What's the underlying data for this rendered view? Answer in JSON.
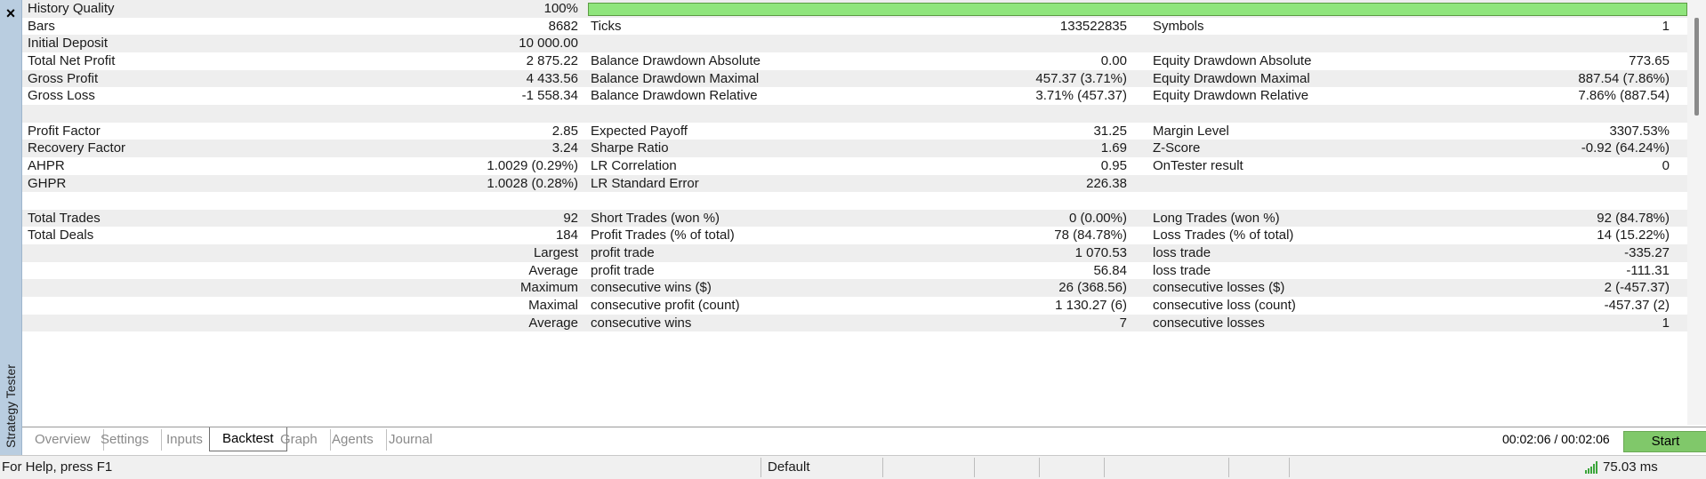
{
  "panel": {
    "title": "Strategy Tester",
    "close_glyph": "×"
  },
  "rows": [
    {
      "shade": true,
      "l1": "History Quality",
      "v1": "100%",
      "bar_fill": 1.0
    },
    {
      "shade": false,
      "l1": "Bars",
      "v1": "8682",
      "l2": "Ticks",
      "v2": "133522835",
      "l3": "Symbols",
      "v3": "1"
    },
    {
      "shade": true,
      "l1": "Initial Deposit",
      "v1": "10 000.00"
    },
    {
      "shade": false,
      "l1": "Total Net Profit",
      "v1": "2 875.22",
      "l2": "Balance Drawdown Absolute",
      "v2": "0.00",
      "l3": "Equity Drawdown Absolute",
      "v3": "773.65"
    },
    {
      "shade": true,
      "l1": "Gross Profit",
      "v1": "4 433.56",
      "l2": "Balance Drawdown Maximal",
      "v2": "457.37 (3.71%)",
      "l3": "Equity Drawdown Maximal",
      "v3": "887.54 (7.86%)"
    },
    {
      "shade": false,
      "l1": "Gross Loss",
      "v1": "-1 558.34",
      "l2": "Balance Drawdown Relative",
      "v2": "3.71% (457.37)",
      "l3": "Equity Drawdown Relative",
      "v3": "7.86% (887.54)"
    },
    {
      "shade": true
    },
    {
      "shade": false,
      "l1": "Profit Factor",
      "v1": "2.85",
      "l2": "Expected Payoff",
      "v2": "31.25",
      "l3": "Margin Level",
      "v3": "3307.53%"
    },
    {
      "shade": true,
      "l1": "Recovery Factor",
      "v1": "3.24",
      "l2": "Sharpe Ratio",
      "v2": "1.69",
      "l3": "Z-Score",
      "v3": "-0.92 (64.24%)"
    },
    {
      "shade": false,
      "l1": "AHPR",
      "v1": "1.0029 (0.29%)",
      "l2": "LR Correlation",
      "v2": "0.95",
      "l3": "OnTester result",
      "v3": "0"
    },
    {
      "shade": true,
      "l1": "GHPR",
      "v1": "1.0028 (0.28%)",
      "l2": "LR Standard Error",
      "v2": "226.38"
    },
    {
      "shade": false
    },
    {
      "shade": true,
      "l1": "Total Trades",
      "v1": "92",
      "l2": "Short Trades (won %)",
      "v2": "0 (0.00%)",
      "l3": "Long Trades (won %)",
      "v3": "92 (84.78%)"
    },
    {
      "shade": false,
      "l1": "Total Deals",
      "v1": "184",
      "l2": "Profit Trades (% of total)",
      "v2": "78 (84.78%)",
      "l3": "Loss Trades (% of total)",
      "v3": "14 (15.22%)"
    },
    {
      "shade": true,
      "r1": "Largest",
      "l2": "profit trade",
      "v2": "1 070.53",
      "l3": "loss trade",
      "v3": "-335.27"
    },
    {
      "shade": false,
      "r1": "Average",
      "l2": "profit trade",
      "v2": "56.84",
      "l3": "loss trade",
      "v3": "-111.31"
    },
    {
      "shade": true,
      "r1": "Maximum",
      "l2": "consecutive wins ($)",
      "v2": "26 (368.56)",
      "l3": "consecutive losses ($)",
      "v3": "2 (-457.37)"
    },
    {
      "shade": false,
      "r1": "Maximal",
      "l2": "consecutive profit (count)",
      "v2": "1 130.27 (6)",
      "l3": "consecutive loss (count)",
      "v3": "-457.37 (2)"
    },
    {
      "shade": true,
      "r1": "Average",
      "l2": "consecutive wins",
      "v2": "7",
      "l3": "consecutive losses",
      "v3": "1"
    }
  ],
  "tabs": [
    {
      "label": "Overview",
      "active": false
    },
    {
      "label": "Settings",
      "active": false
    },
    {
      "label": "Inputs",
      "active": false
    },
    {
      "label": "Backtest",
      "active": true
    },
    {
      "label": "Graph",
      "active": false
    },
    {
      "label": "Agents",
      "active": false
    },
    {
      "label": "Journal",
      "active": false
    }
  ],
  "timer": "00:02:06 / 00:02:06",
  "start_label": "Start",
  "status": {
    "help": "For Help, press F1",
    "profile": "Default",
    "ping": "75.03 ms"
  },
  "colors": {
    "quality_bar": "#8fe57c",
    "start_button": "#80c86a",
    "side_strip": "#b9cde0",
    "row_shade": "#eeeeee"
  },
  "icons": {
    "close": "close-icon",
    "signal": "signal-strength-icon"
  }
}
